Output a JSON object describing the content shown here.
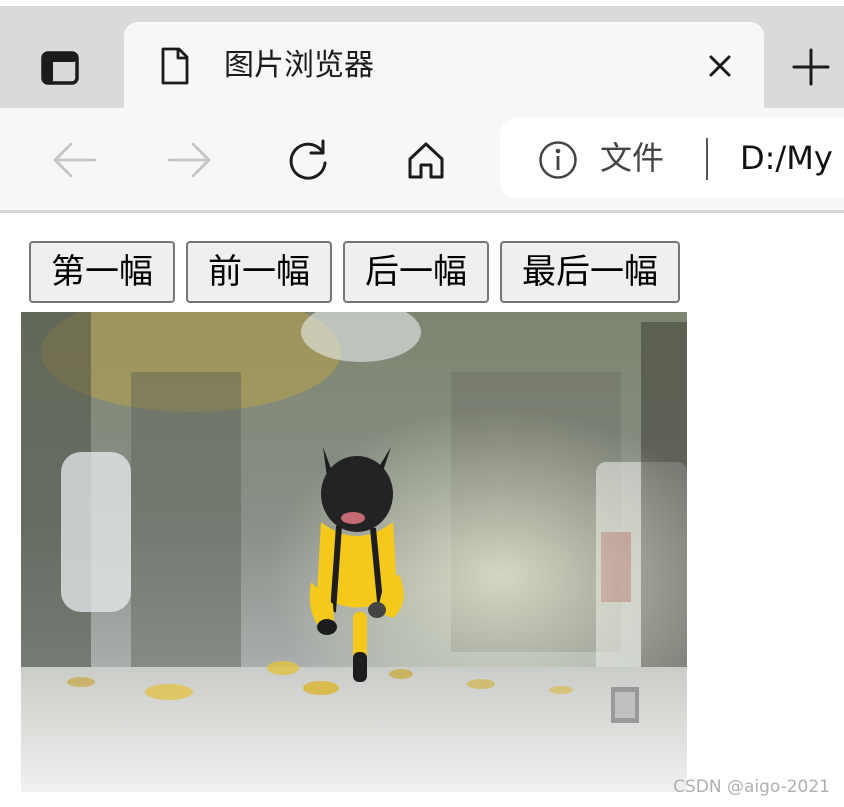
{
  "browser": {
    "tab": {
      "title": "图片浏览器",
      "close_icon": "close-icon",
      "page_icon": "document-icon"
    },
    "new_tab_icon": "plus-icon",
    "tab_actions_icon": "tab-actions-icon",
    "toolbar": {
      "back_icon": "back-arrow-icon",
      "forward_icon": "forward-arrow-icon",
      "refresh_icon": "refresh-icon",
      "home_icon": "home-icon"
    },
    "address": {
      "info_icon": "info-icon",
      "scheme_label": "文件",
      "url": "D:/My"
    }
  },
  "page": {
    "buttons": [
      {
        "label": "第一幅"
      },
      {
        "label": "前一幅"
      },
      {
        "label": "后一幅"
      },
      {
        "label": "最后一幅"
      }
    ],
    "image": {
      "subject": "French bulldog in yellow outfit running on leaf-covered street"
    }
  },
  "watermark": "CSDN @aigo-2021",
  "colors": {
    "tabstrip_bg": "#dadada",
    "active_tab_bg": "#f7f7f7",
    "toolbar_bg": "#f7f7f7",
    "button_bg": "#efefef",
    "button_border": "#767676",
    "dog_outfit": "#f4c91c"
  }
}
